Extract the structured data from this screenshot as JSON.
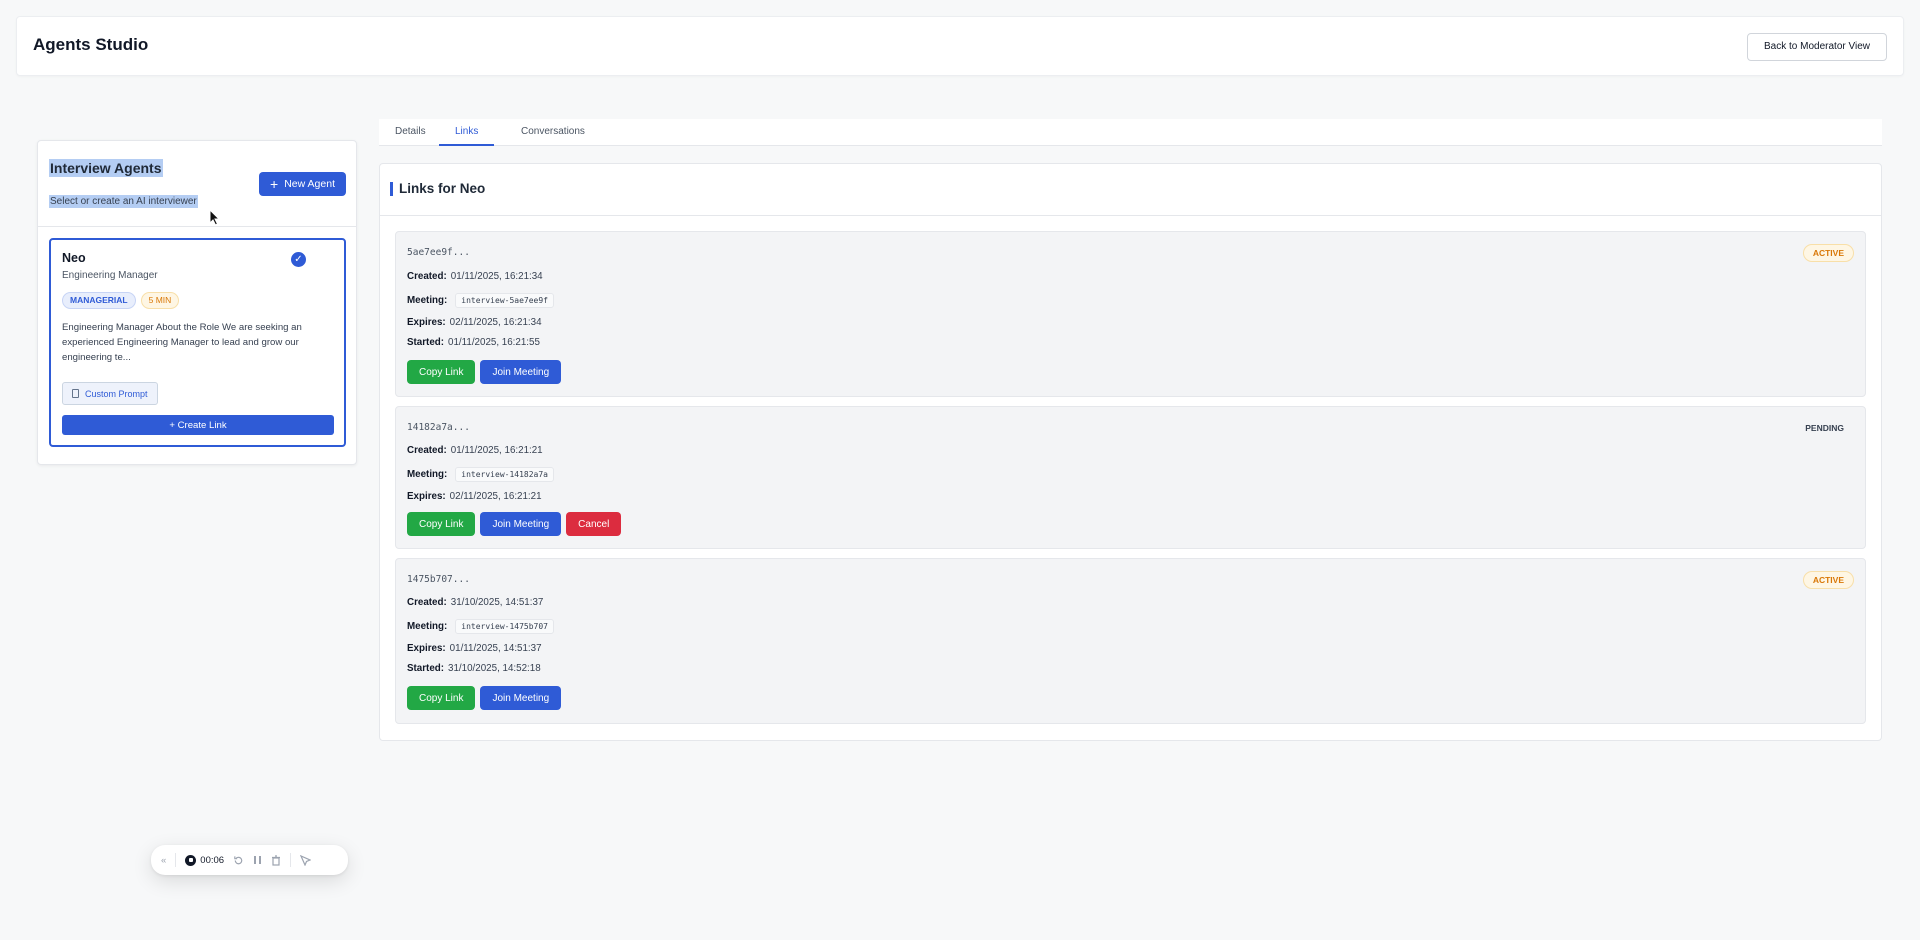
{
  "header": {
    "title": "Agents Studio",
    "back_label": "Back to Moderator View"
  },
  "agents_panel": {
    "title": "Interview Agents",
    "subtitle": "Select or create an AI interviewer",
    "new_agent_label": "New Agent",
    "agent": {
      "name": "Neo",
      "role": "Engineering Manager",
      "tags": [
        "MANAGERIAL",
        "5 MIN"
      ],
      "description": "Engineering Manager About the Role We are seeking an experienced Engineering Manager to lead and grow our engineering te...",
      "custom_prompt_label": "Custom Prompt",
      "create_link_label": "+ Create Link"
    }
  },
  "tabs": [
    {
      "label": "Details",
      "active": false
    },
    {
      "label": "Links",
      "active": true
    },
    {
      "label": "Conversations",
      "active": false
    }
  ],
  "links_panel": {
    "title": "Links for Neo",
    "labels": {
      "created": "Created:",
      "meeting": "Meeting:",
      "expires": "Expires:",
      "started": "Started:"
    },
    "buttons": {
      "copy": "Copy Link",
      "join": "Join Meeting",
      "cancel": "Cancel"
    },
    "links": [
      {
        "id": "5ae7ee9f...",
        "status": "ACTIVE",
        "created": "01/11/2025, 16:21:34",
        "meeting": "interview-5ae7ee9f",
        "expires": "02/11/2025, 16:21:34",
        "started": "01/11/2025, 16:21:55"
      },
      {
        "id": "14182a7a...",
        "status": "PENDING",
        "created": "01/11/2025, 16:21:21",
        "meeting": "interview-14182a7a",
        "expires": "02/11/2025, 16:21:21"
      },
      {
        "id": "1475b707...",
        "status": "ACTIVE",
        "created": "31/10/2025, 14:51:37",
        "meeting": "interview-1475b707",
        "expires": "01/11/2025, 14:51:37",
        "started": "31/10/2025, 14:52:18"
      }
    ]
  },
  "recorder": {
    "time": "00:06"
  },
  "colors": {
    "accent": "#2f5bd6",
    "green": "#22a845",
    "red": "#dc2c3f",
    "warning": "#d97706"
  }
}
